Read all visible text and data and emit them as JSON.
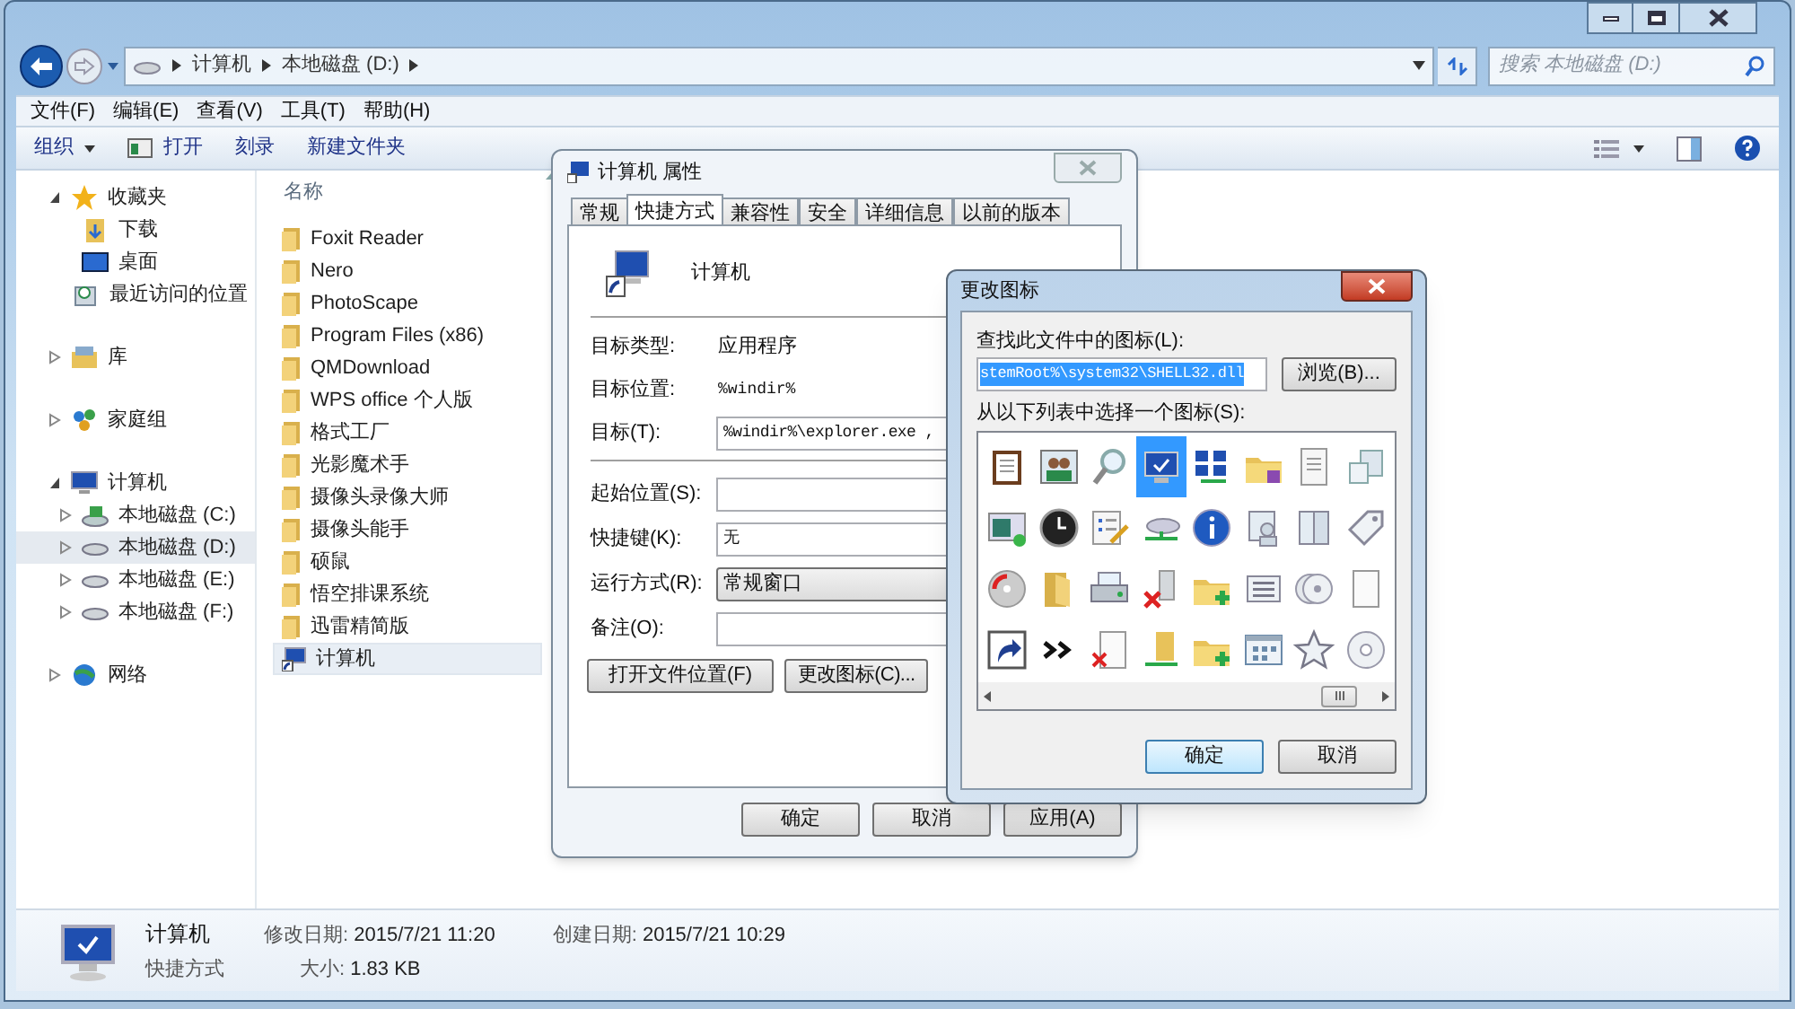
{
  "explorer": {
    "address": {
      "crumbs": [
        "计算机",
        "本地磁盘 (D:)"
      ]
    },
    "search": {
      "placeholder": "搜索 本地磁盘 (D:)"
    },
    "menu": [
      "文件(F)",
      "编辑(E)",
      "查看(V)",
      "工具(T)",
      "帮助(H)"
    ],
    "toolbar": [
      {
        "label": "组织",
        "kind": "menu"
      },
      {
        "label": "打开",
        "kind": "icon"
      },
      {
        "label": "刻录",
        "kind": "plain"
      },
      {
        "label": "新建文件夹",
        "kind": "plain"
      }
    ],
    "nav": [
      {
        "label": "收藏夹",
        "kind": "star",
        "expanded": true,
        "selected": false,
        "children": [
          {
            "label": "下载",
            "kind": "download",
            "selected": false
          },
          {
            "label": "桌面",
            "kind": "desktop",
            "selected": false
          },
          {
            "label": "最近访问的位置",
            "kind": "recent",
            "selected": false
          }
        ]
      },
      {
        "label": "库",
        "kind": "library",
        "expanded": false,
        "selected": false
      },
      {
        "label": "家庭组",
        "kind": "homegroup",
        "expanded": false,
        "selected": false
      },
      {
        "label": "计算机",
        "kind": "computer",
        "expanded": true,
        "selected": false,
        "children": [
          {
            "label": "本地磁盘 (C:)",
            "kind": "systemdrive",
            "expanded": false,
            "selected": false
          },
          {
            "label": "本地磁盘 (D:)",
            "kind": "drive",
            "expanded": false,
            "selected": true
          },
          {
            "label": "本地磁盘 (E:)",
            "kind": "drive",
            "expanded": false,
            "selected": false
          },
          {
            "label": "本地磁盘 (F:)",
            "kind": "drive",
            "expanded": false,
            "selected": false
          }
        ]
      },
      {
        "label": "网络",
        "kind": "network",
        "expanded": false,
        "selected": false
      }
    ],
    "file_list": {
      "column": "名称",
      "files": [
        {
          "name": "Foxit Reader",
          "kind": "folder",
          "selected": false
        },
        {
          "name": "Nero",
          "kind": "folder",
          "selected": false
        },
        {
          "name": "PhotoScape",
          "kind": "folder",
          "selected": false
        },
        {
          "name": "Program Files (x86)",
          "kind": "folder",
          "selected": false
        },
        {
          "name": "QMDownload",
          "kind": "folder",
          "selected": false
        },
        {
          "name": "WPS office 个人版",
          "kind": "folder",
          "selected": false
        },
        {
          "name": "格式工厂",
          "kind": "folder",
          "selected": false
        },
        {
          "name": "光影魔术手",
          "kind": "folder",
          "selected": false
        },
        {
          "name": "摄像头录像大师",
          "kind": "folder",
          "selected": false
        },
        {
          "name": "摄像头能手",
          "kind": "folder",
          "selected": false
        },
        {
          "name": "硕鼠",
          "kind": "folder",
          "selected": false
        },
        {
          "name": "悟空排课系统",
          "kind": "folder",
          "selected": false
        },
        {
          "name": "迅雷精简版",
          "kind": "folder",
          "selected": false
        },
        {
          "name": "计算机",
          "kind": "shortcut",
          "selected": true
        }
      ]
    },
    "details": {
      "name": "计算机",
      "type": "快捷方式",
      "modified": {
        "label": "修改日期:",
        "value": "2015/7/21 11:20"
      },
      "created": {
        "label": "创建日期:",
        "value": "2015/7/21 10:29"
      },
      "size": {
        "label": "大小:",
        "value": "1.83 KB"
      }
    }
  },
  "properties": {
    "title": "计算机 属性",
    "tabs": [
      {
        "label": "常规",
        "selected": false
      },
      {
        "label": "快捷方式",
        "selected": true
      },
      {
        "label": "兼容性",
        "selected": false
      },
      {
        "label": "安全",
        "selected": false
      },
      {
        "label": "详细信息",
        "selected": false
      },
      {
        "label": "以前的版本",
        "selected": false
      }
    ],
    "name": "计算机",
    "target_rows": [
      {
        "label": "目标类型:",
        "value": "应用程序",
        "kind": "text"
      },
      {
        "label": "目标位置:",
        "value": "%windir%",
        "kind": "mono"
      },
      {
        "label": "目标(T):",
        "value": "%windir%\\explorer.exe ,",
        "kind": "field"
      }
    ],
    "option_rows": [
      {
        "label": "起始位置(S):",
        "kind": "field"
      },
      {
        "label": "快捷键(K):",
        "value": "无",
        "kind": "field"
      },
      {
        "label": "运行方式(R):",
        "value": "常规窗口",
        "kind": "select"
      },
      {
        "label": "备注(O):",
        "kind": "field"
      }
    ],
    "actions": [
      "打开文件位置(F)",
      "更改图标(C)..."
    ],
    "buttons": [
      "确定",
      "取消",
      "应用(A)"
    ]
  },
  "change_icon": {
    "title": "更改图标",
    "file_label": "查找此文件中的图标(L):",
    "file_value": "stemRoot%\\system32\\SHELL32.dll",
    "browse": "浏览(B)...",
    "list_label": "从以下列表中选择一个图标(S):",
    "icons": [
      {
        "kind": "clipboard",
        "selected": false
      },
      {
        "kind": "people",
        "selected": false
      },
      {
        "kind": "magnifier",
        "selected": false
      },
      {
        "kind": "computer",
        "selected": true
      },
      {
        "kind": "network",
        "selected": false
      },
      {
        "kind": "folderdisk",
        "selected": false
      },
      {
        "kind": "document",
        "selected": false
      },
      {
        "kind": "windows",
        "selected": false
      },
      {
        "kind": "slideshow",
        "selected": false
      },
      {
        "kind": "clock",
        "selected": false
      },
      {
        "kind": "checklist",
        "selected": false
      },
      {
        "kind": "drivenet",
        "selected": false
      },
      {
        "kind": "info",
        "selected": false
      },
      {
        "kind": "userframe",
        "selected": false
      },
      {
        "kind": "panels",
        "selected": false
      },
      {
        "kind": "tag",
        "selected": false
      },
      {
        "kind": "reddisc",
        "selected": false
      },
      {
        "kind": "openfolder",
        "selected": false
      },
      {
        "kind": "printer",
        "selected": false
      },
      {
        "kind": "deleteshare",
        "selected": false
      },
      {
        "kind": "folderadd",
        "selected": false
      },
      {
        "kind": "list",
        "selected": false
      },
      {
        "kind": "discs",
        "selected": false
      },
      {
        "kind": "page",
        "selected": false
      },
      {
        "kind": "shortcut",
        "selected": false
      },
      {
        "kind": "chevrons",
        "selected": false
      },
      {
        "kind": "deletedoc",
        "selected": false
      },
      {
        "kind": "foldershare",
        "selected": false
      },
      {
        "kind": "folderadd",
        "selected": false
      },
      {
        "kind": "grid",
        "selected": false
      },
      {
        "kind": "star",
        "selected": false
      },
      {
        "kind": "disc",
        "selected": false
      }
    ],
    "buttons": [
      {
        "label": "确定",
        "default": true
      },
      {
        "label": "取消",
        "default": false
      }
    ]
  }
}
